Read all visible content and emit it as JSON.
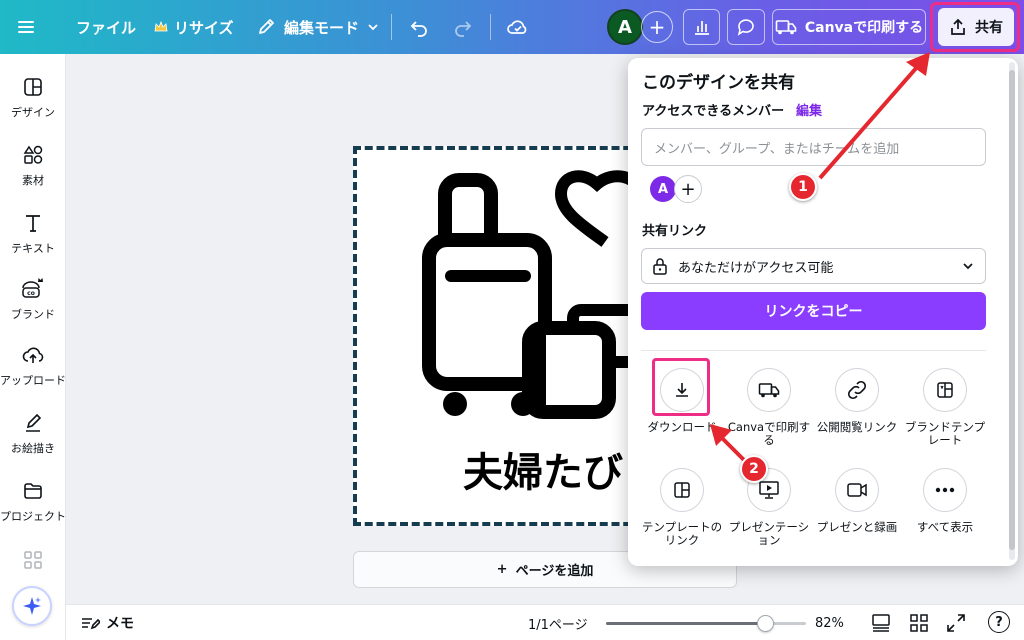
{
  "topbar": {
    "file_label": "ファイル",
    "resize_label": "リサイズ",
    "edit_mode_label": "編集モード",
    "avatar_initial": "A",
    "print_label": "Canvaで印刷する",
    "share_label": "共有"
  },
  "sidebar": {
    "items": [
      {
        "label": "デザイン",
        "icon": "design-icon"
      },
      {
        "label": "素材",
        "icon": "elements-icon"
      },
      {
        "label": "テキスト",
        "icon": "text-icon"
      },
      {
        "label": "ブランド",
        "icon": "brand-icon"
      },
      {
        "label": "アップロード",
        "icon": "upload-icon"
      },
      {
        "label": "お絵描き",
        "icon": "draw-icon"
      },
      {
        "label": "プロジェクト",
        "icon": "folder-icon"
      }
    ]
  },
  "canvas": {
    "design_text": "夫婦たび",
    "add_page_label": "ページを追加"
  },
  "bottombar": {
    "notes_label": "メモ",
    "page_indicator": "1/1ページ",
    "zoom_level": "82%",
    "zoom_fraction": 0.82
  },
  "share_panel": {
    "title": "このデザインを共有",
    "access_label": "アクセスできるメンバー",
    "edit_link": "編集",
    "input_placeholder": "メンバー、グループ、またはチームを追加",
    "member_initial": "A",
    "share_link_label": "共有リンク",
    "access_option": "あなただけがアクセス可能",
    "copy_button": "リンクをコピー",
    "options": [
      {
        "label": "ダウンロード",
        "icon": "download-icon"
      },
      {
        "label": "Canvaで印刷する",
        "icon": "truck-icon"
      },
      {
        "label": "公開閲覧リンク",
        "icon": "link-icon"
      },
      {
        "label": "ブランドテンプレート",
        "icon": "brand-template-icon"
      },
      {
        "label": "テンプレートのリンク",
        "icon": "template-icon"
      },
      {
        "label": "プレゼンテーション",
        "icon": "presentation-icon"
      },
      {
        "label": "プレゼンと録画",
        "icon": "camera-icon"
      },
      {
        "label": "すべて表示",
        "icon": "more-icon"
      }
    ]
  },
  "annotations": {
    "step1": "1",
    "step2": "2",
    "arrow_color": "#e5282f",
    "highlight_color": "#ee2e86"
  },
  "colors": {
    "accent": "#8b3dff",
    "edit_link": "#7d2ae8",
    "avatar_bg": "#0b5a24"
  }
}
